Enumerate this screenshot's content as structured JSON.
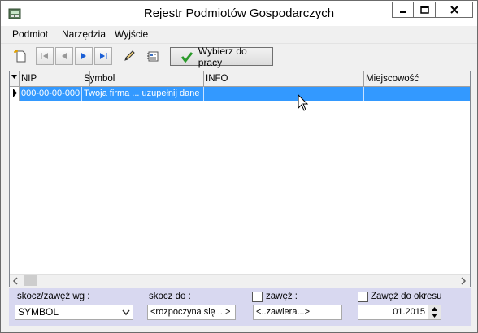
{
  "window": {
    "title": "Rejestr Podmiotów Gospodarczych"
  },
  "menu": {
    "items": [
      "Podmiot",
      "Narzędzia",
      "Wyjście"
    ]
  },
  "toolbar": {
    "select_label": "Wybierz do pracy"
  },
  "grid": {
    "columns": [
      "NIP",
      "Symbol",
      "INFO",
      "Miejscowość"
    ],
    "rows": [
      {
        "nip": "000-00-00-000",
        "symbol": "Twoja firma ... uzupełnij dane",
        "info": "",
        "city": ""
      }
    ]
  },
  "filter": {
    "sort_label": "skocz/zawęź wg :",
    "sort_value": "SYMBOL",
    "jump_label": "skocz do :",
    "jump_placeholder": "<rozpoczyna się ...>",
    "narrow_label": "zawęź :",
    "narrow_placeholder": "<..zawiera...>",
    "period_label": "Zawęź do okresu",
    "period_value": "01.2015"
  }
}
